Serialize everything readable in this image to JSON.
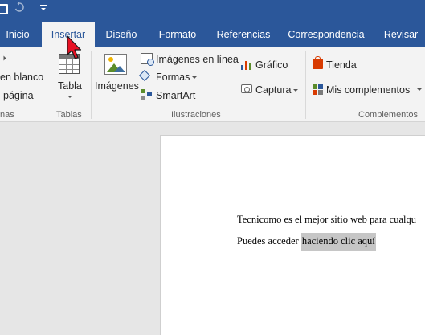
{
  "quick_access": {
    "save_icon": "save-icon",
    "undo_icon": "undo-icon",
    "customize_icon": "customize-qat-icon"
  },
  "tabs": [
    {
      "label": "Inicio"
    },
    {
      "label": "Insertar",
      "active": true
    },
    {
      "label": "Diseño"
    },
    {
      "label": "Formato"
    },
    {
      "label": "Referencias"
    },
    {
      "label": "Correspondencia"
    },
    {
      "label": "Revisar"
    }
  ],
  "ribbon": {
    "pages_group": {
      "blank_page_label": "en blanco",
      "page_break_label": "página",
      "group_label": "nas"
    },
    "tables_group": {
      "table_label": "Tabla",
      "group_label": "Tablas"
    },
    "illustrations_group": {
      "images_label": "Imágenes",
      "online_images_label": "Imágenes en línea",
      "shapes_label": "Formas",
      "smartart_label": "SmartArt",
      "chart_label": "Gráfico",
      "screenshot_label": "Captura",
      "group_label": "Ilustraciones"
    },
    "addins_group": {
      "store_label": "Tienda",
      "my_addins_label": "Mis complementos",
      "group_label": "Complementos"
    }
  },
  "document": {
    "line1": "Tecnicomo es el mejor sitio web para cualqu",
    "line2_prefix": "Puedes acceder ",
    "line2_selected": "haciendo clic aquí"
  },
  "colors": {
    "brand_blue": "#2b579a",
    "ribbon_bg": "#f3f3f3",
    "canvas_bg": "#e6e6e6",
    "selection": "#c6c6c6",
    "cursor_red": "#e81123"
  }
}
